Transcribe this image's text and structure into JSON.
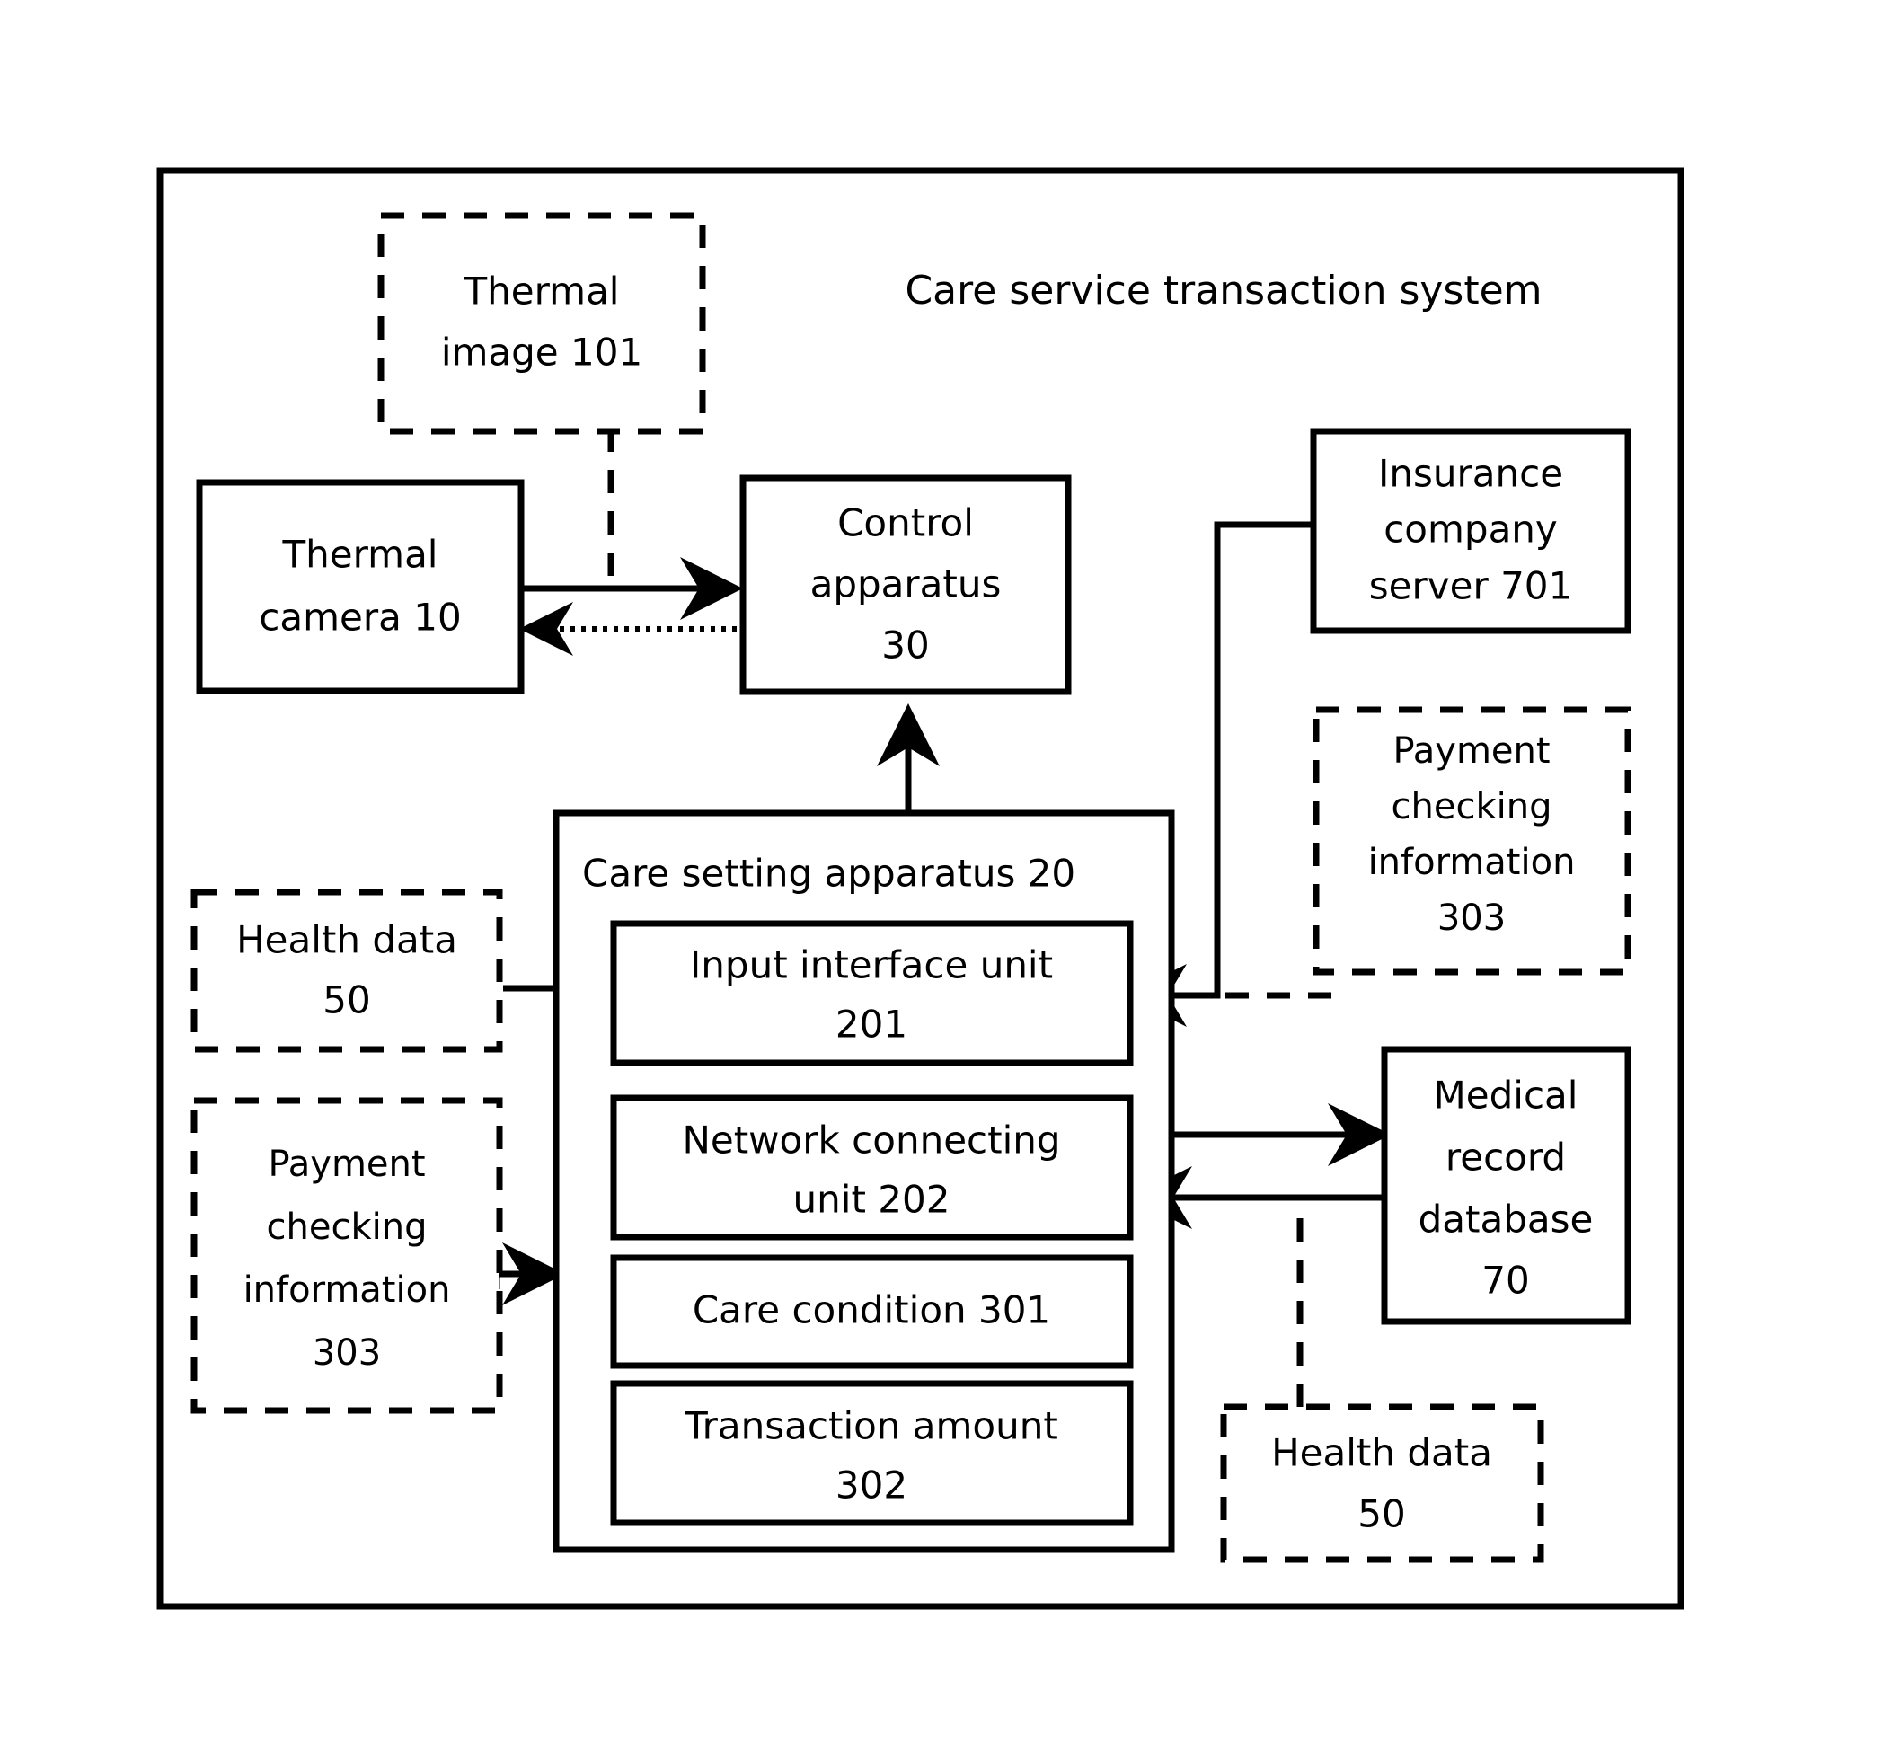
{
  "figure": {
    "title": "Care service transaction system",
    "outer_frame_name": "system-boundary"
  },
  "nodes": {
    "thermal_image": {
      "line1": "Thermal",
      "line2": "image  101",
      "style": "dashed"
    },
    "thermal_camera": {
      "line1": "Thermal",
      "line2": "camera  10",
      "style": "solid"
    },
    "control_apparatus": {
      "line1": "Control",
      "line2": "apparatus",
      "line3": "30",
      "style": "solid"
    },
    "insurance_server": {
      "line1": "Insurance",
      "line2": "company",
      "line3": "server  701",
      "style": "solid"
    },
    "payment_checking_right": {
      "line1": "Payment",
      "line2": "checking",
      "line3": "information",
      "line4": "303",
      "style": "dashed"
    },
    "health_data_left": {
      "line1": "Health data",
      "line2": "50",
      "style": "dashed"
    },
    "payment_checking_left": {
      "line1": "Payment",
      "line2": "checking",
      "line3": "information",
      "line4": "303",
      "style": "dashed"
    },
    "care_setting_apparatus": {
      "label": "Care setting apparatus  20",
      "style": "solid"
    },
    "input_interface_unit": {
      "line1": "Input interface unit",
      "line2": "201",
      "style": "solid"
    },
    "network_connecting_unit": {
      "line1": "Network connecting",
      "line2": "unit  202",
      "style": "solid"
    },
    "care_condition": {
      "line1": "Care condition 301",
      "style": "solid"
    },
    "transaction_amount": {
      "line1": "Transaction amount",
      "line2": "302",
      "style": "solid"
    },
    "medical_record_database": {
      "line1": "Medical",
      "line2": "record",
      "line3": "database",
      "line4": "70",
      "style": "solid"
    },
    "health_data_bottom": {
      "line1": "Health data",
      "line2": "50",
      "style": "dashed"
    }
  },
  "connections": [
    {
      "name": "thermal-camera-to-control",
      "from": "thermal_camera",
      "to": "control_apparatus",
      "style": "solid",
      "arrow": "right"
    },
    {
      "name": "control-to-thermal-camera",
      "from": "control_apparatus",
      "to": "thermal_camera",
      "style": "dotted",
      "arrow": "left"
    },
    {
      "name": "thermal-image-to-link",
      "from": "thermal_image",
      "to": "thermal-camera-to-control",
      "style": "dashed",
      "arrow": "none"
    },
    {
      "name": "care-setting-to-control",
      "from": "care_setting_apparatus",
      "to": "control_apparatus",
      "style": "solid",
      "arrow": "up"
    },
    {
      "name": "insurance-server-to-input-interface",
      "from": "insurance_server",
      "to": "input_interface_unit",
      "style": "solid",
      "arrow": "left"
    },
    {
      "name": "payment-checking-right-to-link",
      "from": "payment_checking_right",
      "to": "insurance-server-to-input-interface",
      "style": "dashed",
      "arrow": "none"
    },
    {
      "name": "health-data-left-to-input-interface",
      "from": "health_data_left",
      "to": "input_interface_unit",
      "style": "solid",
      "arrow": "right"
    },
    {
      "name": "payment-checking-left-to-care-setting",
      "from": "payment_checking_left",
      "to": "care_setting_apparatus",
      "style": "solid",
      "arrow": "right"
    },
    {
      "name": "network-unit-to-medical-db",
      "from": "network_connecting_unit",
      "to": "medical_record_database",
      "style": "solid",
      "arrow": "right"
    },
    {
      "name": "medical-db-to-network-unit",
      "from": "medical_record_database",
      "to": "network_connecting_unit",
      "style": "solid",
      "arrow": "left"
    },
    {
      "name": "health-data-bottom-to-link",
      "from": "health_data_bottom",
      "to": "medical-db-to-network-unit",
      "style": "dashed",
      "arrow": "none"
    }
  ],
  "colors": {
    "stroke": "#000000",
    "fill": "#ffffff",
    "text": "#000000"
  }
}
